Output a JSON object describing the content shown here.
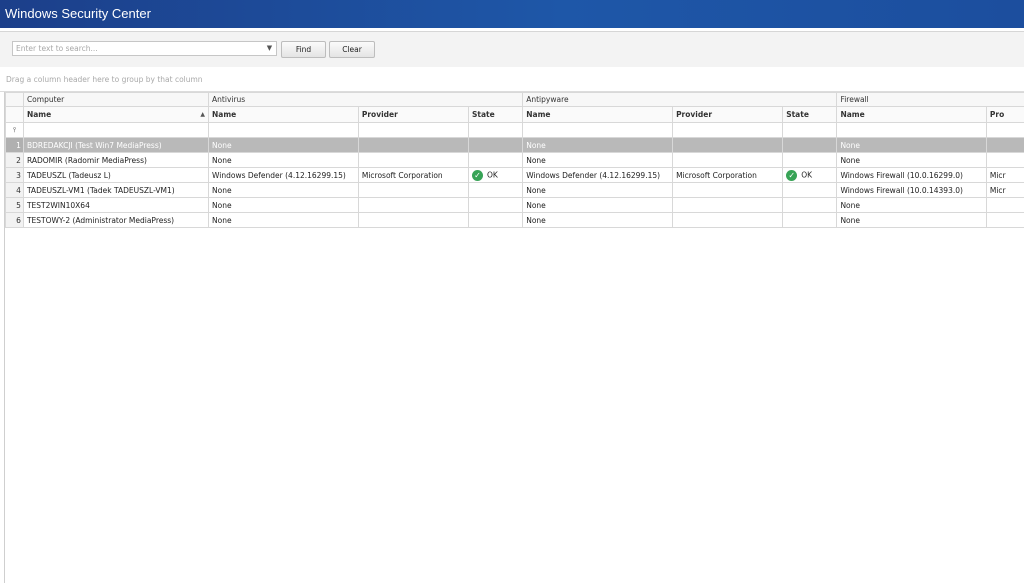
{
  "window": {
    "title": "Windows Security Center"
  },
  "toolbar": {
    "search_placeholder": "Enter text to search...",
    "find_label": "Find",
    "clear_label": "Clear"
  },
  "group_panel": {
    "hint": "Drag a column header here to group by that column"
  },
  "bands": {
    "computer": "Computer",
    "antivirus": "Antivirus",
    "antispyware": "Antipyware",
    "firewall": "Firewall"
  },
  "columns": {
    "name": "Name",
    "provider": "Provider",
    "state": "State",
    "provider_partial": "Pro"
  },
  "rows": [
    {
      "num": "1",
      "computer": "BDREDAKCJI (Test Win7 MediaPress)",
      "av_name": "None",
      "av_provider": "",
      "av_state": "",
      "as_name": "None",
      "as_provider": "",
      "as_state": "",
      "fw_name": "None",
      "fw_provider": ""
    },
    {
      "num": "2",
      "computer": "RADOMIR (Radomir MediaPress)",
      "av_name": "None",
      "av_provider": "",
      "av_state": "",
      "as_name": "None",
      "as_provider": "",
      "as_state": "",
      "fw_name": "None",
      "fw_provider": ""
    },
    {
      "num": "3",
      "computer": "TADEUSZL (Tadeusz L)",
      "av_name": "Windows Defender (4.12.16299.15)",
      "av_provider": "Microsoft Corporation",
      "av_state": "OK",
      "as_name": "Windows Defender (4.12.16299.15)",
      "as_provider": "Microsoft Corporation",
      "as_state": "OK",
      "fw_name": "Windows Firewall (10.0.16299.0)",
      "fw_provider": "Micr"
    },
    {
      "num": "4",
      "computer": "TADEUSZL-VM1 (Tadek TADEUSZL-VM1)",
      "av_name": "None",
      "av_provider": "",
      "av_state": "",
      "as_name": "None",
      "as_provider": "",
      "as_state": "",
      "fw_name": "Windows Firewall (10.0.14393.0)",
      "fw_provider": "Micr"
    },
    {
      "num": "5",
      "computer": "TEST2WIN10X64",
      "av_name": "None",
      "av_provider": "",
      "av_state": "",
      "as_name": "None",
      "as_provider": "",
      "as_state": "",
      "fw_name": "None",
      "fw_provider": ""
    },
    {
      "num": "6",
      "computer": "TESTOWY-2 (Administrator MediaPress)",
      "av_name": "None",
      "av_provider": "",
      "av_state": "",
      "as_name": "None",
      "as_provider": "",
      "as_state": "",
      "fw_name": "None",
      "fw_provider": ""
    }
  ],
  "colors": {
    "titlebar": "#1e57a8",
    "selected_row": "#b9b9b9",
    "ok": "#37a356"
  },
  "icons": {
    "filter": "filter-pin-icon",
    "ok": "check-circle-icon",
    "sort": "sort-ascending-icon",
    "dropdown": "chevron-down-icon"
  }
}
